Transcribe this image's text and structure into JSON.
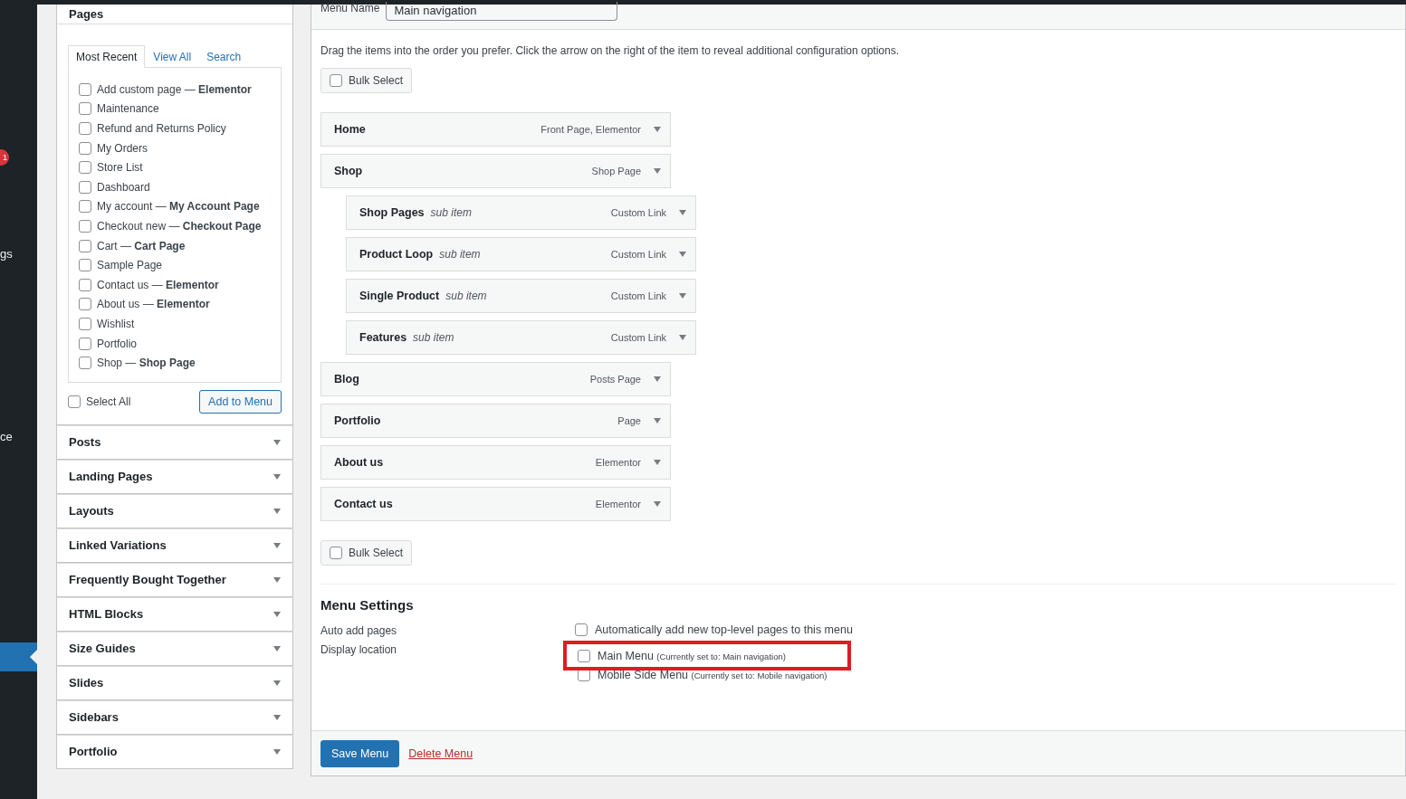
{
  "admin_sidebar": {
    "badge": "1",
    "labels": [
      "gs",
      "ce"
    ],
    "active_item": true
  },
  "pages_panel": {
    "title": "Pages",
    "tabs": [
      {
        "label": "Most Recent",
        "selected": true
      },
      {
        "label": "View All",
        "selected": false
      },
      {
        "label": "Search",
        "selected": false
      }
    ],
    "items": [
      {
        "label": "Add custom page — **Elementor**",
        "checked": false
      },
      {
        "label": "Maintenance",
        "checked": false
      },
      {
        "label": "Refund and Returns Policy",
        "checked": false
      },
      {
        "label": "My Orders",
        "checked": false
      },
      {
        "label": "Store List",
        "checked": false
      },
      {
        "label": "Dashboard",
        "checked": false
      },
      {
        "label": "My account — **My Account Page**",
        "checked": false
      },
      {
        "label": "Checkout new — **Checkout Page**",
        "checked": false
      },
      {
        "label": "Cart — **Cart Page**",
        "checked": false
      },
      {
        "label": "Sample Page",
        "checked": false
      },
      {
        "label": "Contact us — **Elementor**",
        "checked": false
      },
      {
        "label": "About us — **Elementor**",
        "checked": false
      },
      {
        "label": "Wishlist",
        "checked": false
      },
      {
        "label": "Portfolio",
        "checked": false
      },
      {
        "label": "Shop — **Shop Page**",
        "checked": false
      }
    ],
    "select_all": {
      "label": "Select All",
      "checked": false
    },
    "add_button": "Add to Menu"
  },
  "accordion": [
    {
      "label": "Posts"
    },
    {
      "label": "Landing Pages"
    },
    {
      "label": "Layouts"
    },
    {
      "label": "Linked Variations"
    },
    {
      "label": "Frequently Bought Together"
    },
    {
      "label": "HTML Blocks"
    },
    {
      "label": "Size Guides"
    },
    {
      "label": "Slides"
    },
    {
      "label": "Sidebars"
    },
    {
      "label": "Portfolio"
    }
  ],
  "menu_name": {
    "label": "Menu Name",
    "value": "Main navigation"
  },
  "instructions": "Drag the items into the order you prefer. Click the arrow on the right of the item to reveal additional configuration options.",
  "bulk_select_top": {
    "label": "Bulk Select",
    "checked": false
  },
  "menu_items": [
    {
      "title": "Home",
      "type": "Front Page, Elementor"
    },
    {
      "title": "Shop",
      "type": "Shop Page",
      "children": [
        {
          "title": "Shop Pages",
          "note": "sub item",
          "type": "Custom Link"
        },
        {
          "title": "Product Loop",
          "note": "sub item",
          "type": "Custom Link"
        },
        {
          "title": "Single Product",
          "note": "sub item",
          "type": "Custom Link"
        },
        {
          "title": "Features",
          "note": "sub item",
          "type": "Custom Link"
        }
      ]
    },
    {
      "title": "Blog",
      "type": "Posts Page"
    },
    {
      "title": "Portfolio",
      "type": "Page"
    },
    {
      "title": "About us",
      "type": "Elementor"
    },
    {
      "title": "Contact us",
      "type": "Elementor"
    }
  ],
  "bulk_select_bottom": {
    "label": "Bulk Select",
    "checked": false
  },
  "menu_settings": {
    "title": "Menu Settings",
    "auto_add": {
      "label": "Auto add pages",
      "option": "Automatically add new top-level pages to this menu",
      "checked": false
    },
    "display_location": {
      "label": "Display location",
      "locations": [
        {
          "name": "Main Menu",
          "note": "(Currently set to: Main navigation)",
          "checked": false,
          "highlighted": true
        },
        {
          "name": "Mobile Side Menu",
          "note": "(Currently set to: Mobile navigation)",
          "checked": false,
          "highlighted": false
        }
      ]
    }
  },
  "footer": {
    "save_button": "Save Menu",
    "delete_link": "Delete Menu"
  }
}
